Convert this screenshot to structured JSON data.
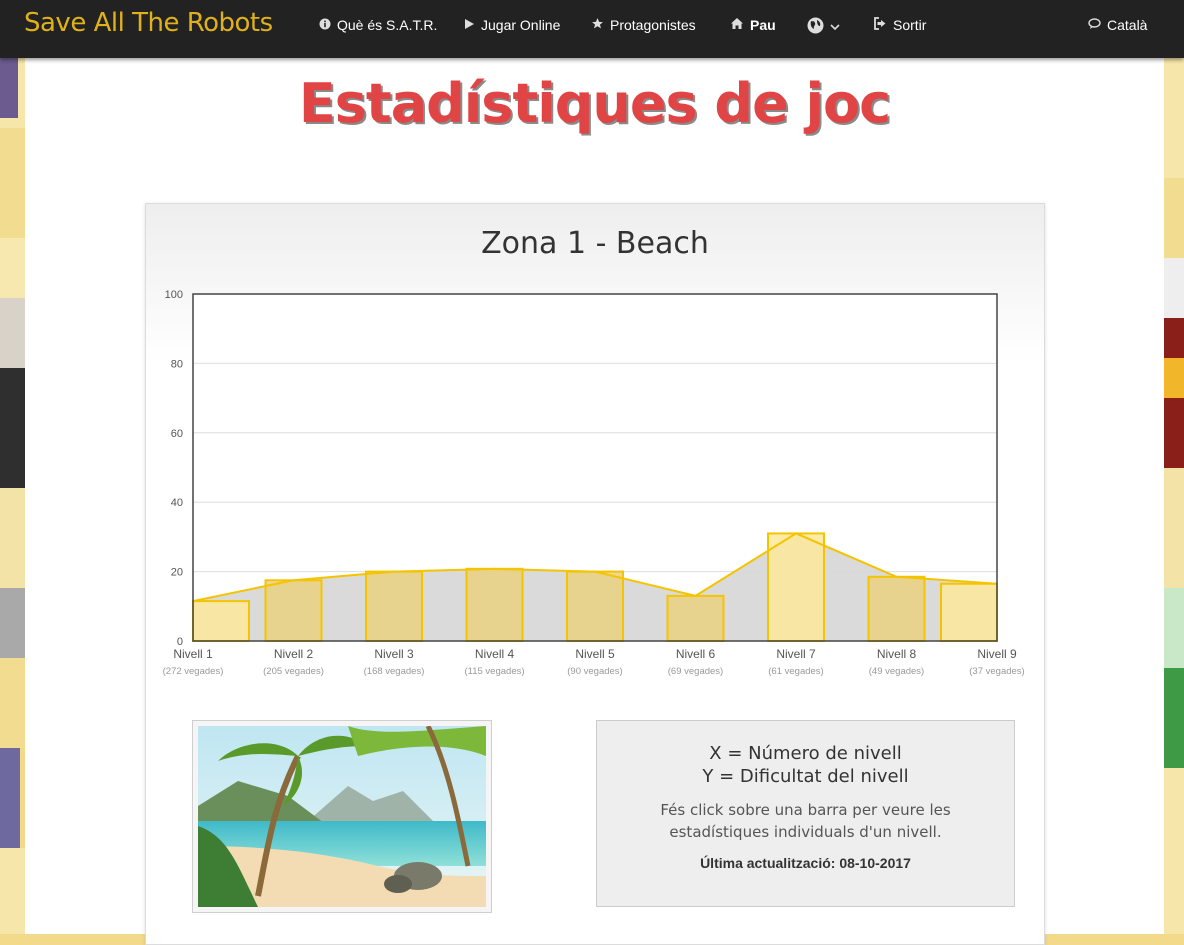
{
  "navbar": {
    "brand": "Save All The Robots",
    "items": [
      {
        "label": "Què és S.A.T.R.",
        "icon": "info-icon"
      },
      {
        "label": "Jugar Online",
        "icon": "play-icon"
      },
      {
        "label": "Protagonistes",
        "icon": "star-icon"
      },
      {
        "label": "Pau",
        "icon": "home-icon"
      },
      {
        "label": "",
        "icon": "globe-icon"
      },
      {
        "label": "Sortir",
        "icon": "logout-icon"
      },
      {
        "label": "Català",
        "icon": "chat-icon"
      }
    ]
  },
  "page": {
    "title": "Estadístiques de joc"
  },
  "chart_data": {
    "type": "bar",
    "title": "Zona 1 - Beach",
    "categories": [
      "Nivell 1",
      "Nivell 2",
      "Nivell 3",
      "Nivell 4",
      "Nivell 5",
      "Nivell 6",
      "Nivell 7",
      "Nivell 8",
      "Nivell 9"
    ],
    "sublabels": [
      "(272 vegades)",
      "(205 vegades)",
      "(168 vegades)",
      "(115 vegades)",
      "(90 vegades)",
      "(69 vegades)",
      "(61 vegades)",
      "(49 vegades)",
      "(37 vegades)"
    ],
    "values": [
      11.5,
      17.5,
      20,
      20.8,
      20,
      13,
      31,
      18.5,
      16.5
    ],
    "ylim": [
      0,
      100
    ],
    "yticks": [
      0,
      20,
      40,
      60,
      80,
      100
    ],
    "grid": true,
    "colors": {
      "bar_fill": "#e9d17f",
      "bar_stroke": "#f5c400",
      "area": "#d6d6d6",
      "line": "#f5c400",
      "edge_bar_fill": "#fde79a"
    }
  },
  "legend": {
    "x_line": "X = Número de nivell",
    "y_line": "Y = Dificultat del nivell",
    "hint": "Fés click sobre una barra per veure les estadístiques individuals d'un nivell.",
    "updated": "Última actualització: 08-10-2017"
  }
}
